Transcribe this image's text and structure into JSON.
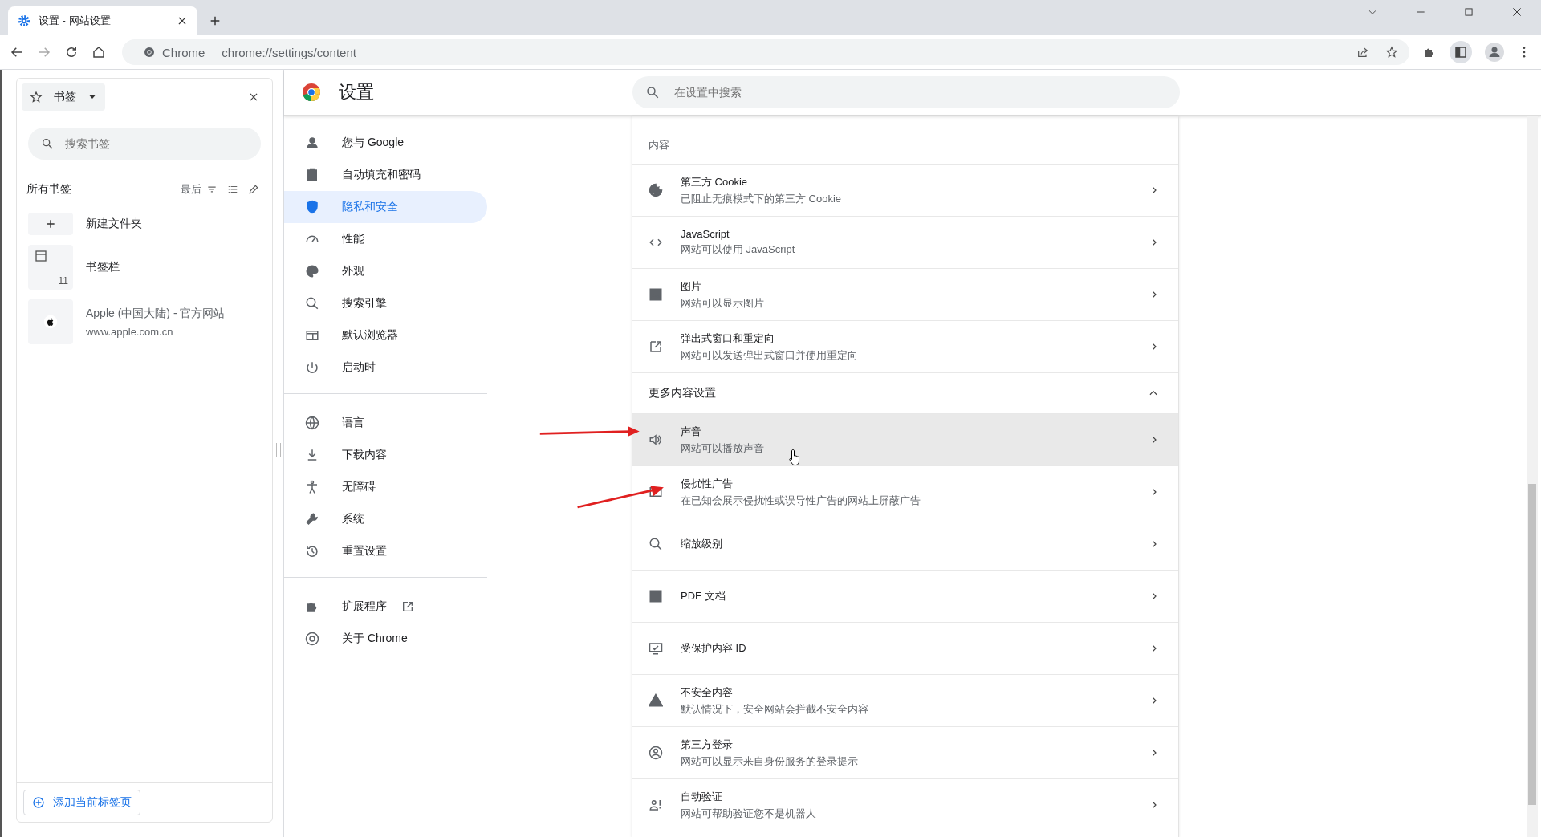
{
  "browser": {
    "tab": {
      "title": "设置 - 网站设置"
    },
    "address": {
      "site": "Chrome",
      "url": "chrome://settings/content"
    }
  },
  "bookmarks": {
    "title": "书签",
    "search": {
      "placeholder": "搜索书签"
    },
    "heading": "所有书签",
    "sort": "最后",
    "items": [
      {
        "kind": "new_folder",
        "title": "新建文件夹"
      },
      {
        "kind": "folder",
        "title": "书签栏",
        "count": "11"
      },
      {
        "kind": "site",
        "title": "Apple (中国大陆) - 官方网站",
        "url": "www.apple.com.cn"
      }
    ],
    "add_button": "添加当前标签页"
  },
  "settings": {
    "title": "设置",
    "search": {
      "placeholder": "在设置中搜索"
    },
    "nav": [
      {
        "items": [
          {
            "label": "您与 Google",
            "selected": false
          },
          {
            "label": "自动填充和密码",
            "selected": false
          },
          {
            "label": "隐私和安全",
            "selected": true
          },
          {
            "label": "性能",
            "selected": false
          },
          {
            "label": "外观",
            "selected": false
          },
          {
            "label": "搜索引擎",
            "selected": false
          },
          {
            "label": "默认浏览器",
            "selected": false
          },
          {
            "label": "启动时",
            "selected": false
          }
        ]
      },
      {
        "items": [
          {
            "label": "语言",
            "selected": false
          },
          {
            "label": "下载内容",
            "selected": false
          },
          {
            "label": "无障碍",
            "selected": false
          },
          {
            "label": "系统",
            "selected": false
          },
          {
            "label": "重置设置",
            "selected": false
          }
        ]
      },
      {
        "items": [
          {
            "label": "扩展程序",
            "selected": false,
            "external": true
          },
          {
            "label": "关于 Chrome",
            "selected": false
          }
        ]
      }
    ],
    "content": {
      "section_title": "内容",
      "rows": [
        {
          "kind": "item",
          "title": "第三方 Cookie",
          "subtitle": "已阻止无痕模式下的第三方 Cookie",
          "highlighted": false
        },
        {
          "kind": "item",
          "title": "JavaScript",
          "subtitle": "网站可以使用 JavaScript",
          "highlighted": false
        },
        {
          "kind": "item",
          "title": "图片",
          "subtitle": "网站可以显示图片",
          "highlighted": false
        },
        {
          "kind": "item",
          "title": "弹出式窗口和重定向",
          "subtitle": "网站可以发送弹出式窗口并使用重定向",
          "highlighted": false
        },
        {
          "kind": "group",
          "title": "更多内容设置",
          "expanded": true
        },
        {
          "kind": "item",
          "title": "声音",
          "subtitle": "网站可以播放声音",
          "highlighted": true
        },
        {
          "kind": "item",
          "title": "侵扰性广告",
          "subtitle": "在已知会展示侵扰性或误导性广告的网站上屏蔽广告",
          "highlighted": false
        },
        {
          "kind": "item",
          "title": "缩放级别",
          "highlighted": false
        },
        {
          "kind": "item",
          "title": "PDF 文档",
          "highlighted": false
        },
        {
          "kind": "item",
          "title": "受保护内容 ID",
          "highlighted": false
        },
        {
          "kind": "item",
          "title": "不安全内容",
          "subtitle": "默认情况下，安全网站会拦截不安全内容",
          "highlighted": false
        },
        {
          "kind": "item",
          "title": "第三方登录",
          "subtitle": "网站可以显示来自身份服务的登录提示",
          "highlighted": false
        },
        {
          "kind": "item",
          "title": "自动验证",
          "subtitle": "网站可帮助验证您不是机器人",
          "highlighted": false
        }
      ]
    }
  }
}
